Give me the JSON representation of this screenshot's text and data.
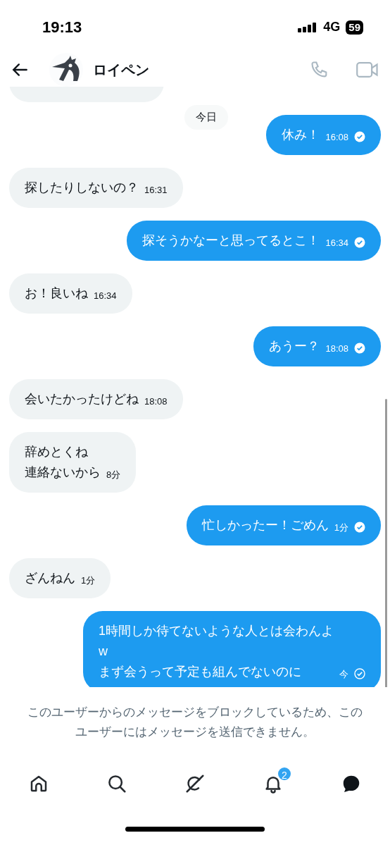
{
  "status_bar": {
    "time": "19:13",
    "network": "4G",
    "battery": "59"
  },
  "header": {
    "name": "ロイペン"
  },
  "date_separator": "今日",
  "messages": [
    {
      "kind": "sent",
      "lines": [
        "休み！"
      ],
      "time": "16:08",
      "read": true
    },
    {
      "kind": "received",
      "lines": [
        "探したりしないの？"
      ],
      "time": "16:31"
    },
    {
      "kind": "sent",
      "lines": [
        "探そうかなーと思ってるとこ！"
      ],
      "time": "16:34",
      "read": true
    },
    {
      "kind": "received",
      "lines": [
        "お！良いね"
      ],
      "time": "16:34"
    },
    {
      "kind": "sent",
      "lines": [
        "あうー？"
      ],
      "time": "18:08",
      "read": true
    },
    {
      "kind": "received",
      "lines": [
        "会いたかったけどね"
      ],
      "time": "18:08"
    },
    {
      "kind": "received",
      "lines": [
        "辞めとくね",
        "連絡ないから"
      ],
      "time": "8分"
    },
    {
      "kind": "sent",
      "lines": [
        "忙しかったー！ごめん"
      ],
      "time": "1分",
      "read": true
    },
    {
      "kind": "received",
      "lines": [
        "ざんねん"
      ],
      "time": "1分"
    },
    {
      "kind": "sent",
      "lines": [
        "1時間しか待てないような人とは会わんよ",
        "w",
        "まず会うって予定も組んでないのに"
      ],
      "time": "今",
      "read": false
    }
  ],
  "notice": "このユーザーからのメッセージをブロックしているため、このユーザーにはメッセージを送信できません。",
  "nav": [
    {
      "kind": "home",
      "selected": false
    },
    {
      "kind": "search",
      "selected": false
    },
    {
      "kind": "grok",
      "selected": false
    },
    {
      "kind": "notifications",
      "selected": false,
      "badge": "2"
    },
    {
      "kind": "messages",
      "selected": true
    }
  ]
}
